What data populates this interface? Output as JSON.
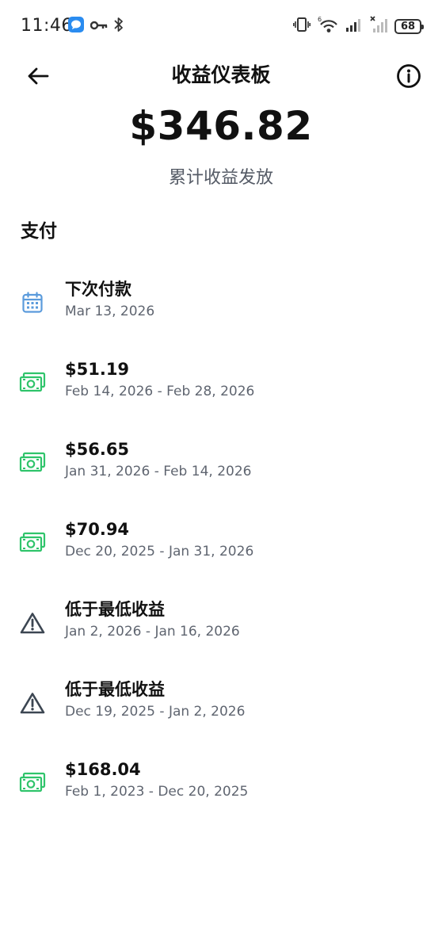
{
  "status_bar": {
    "time": "11:46",
    "battery": "68"
  },
  "header": {
    "title": "收益仪表板"
  },
  "summary": {
    "total": "$346.82",
    "caption": "累计收益发放"
  },
  "section": {
    "title": "支付"
  },
  "payouts": [
    {
      "icon": "calendar-icon",
      "title": "下次付款",
      "date": "Mar 13, 2026"
    },
    {
      "icon": "cash-icon",
      "title": "$51.19",
      "date": "Feb 14, 2026 - Feb 28, 2026"
    },
    {
      "icon": "cash-icon",
      "title": "$56.65",
      "date": "Jan 31, 2026 - Feb 14, 2026"
    },
    {
      "icon": "cash-icon",
      "title": "$70.94",
      "date": "Dec 20, 2025 - Jan 31, 2026"
    },
    {
      "icon": "warning-icon",
      "title": "低于最低收益",
      "date": "Jan 2, 2026 - Jan 16, 2026"
    },
    {
      "icon": "warning-icon",
      "title": "低于最低收益",
      "date": "Dec 19, 2025 - Jan 2, 2026"
    },
    {
      "icon": "cash-icon",
      "title": "$168.04",
      "date": "Feb 1, 2023 - Dec 20, 2025"
    }
  ],
  "colors": {
    "cash_icon": "#2fc46b",
    "calendar_icon": "#5b9bdc",
    "warning_icon": "#3c4652"
  }
}
